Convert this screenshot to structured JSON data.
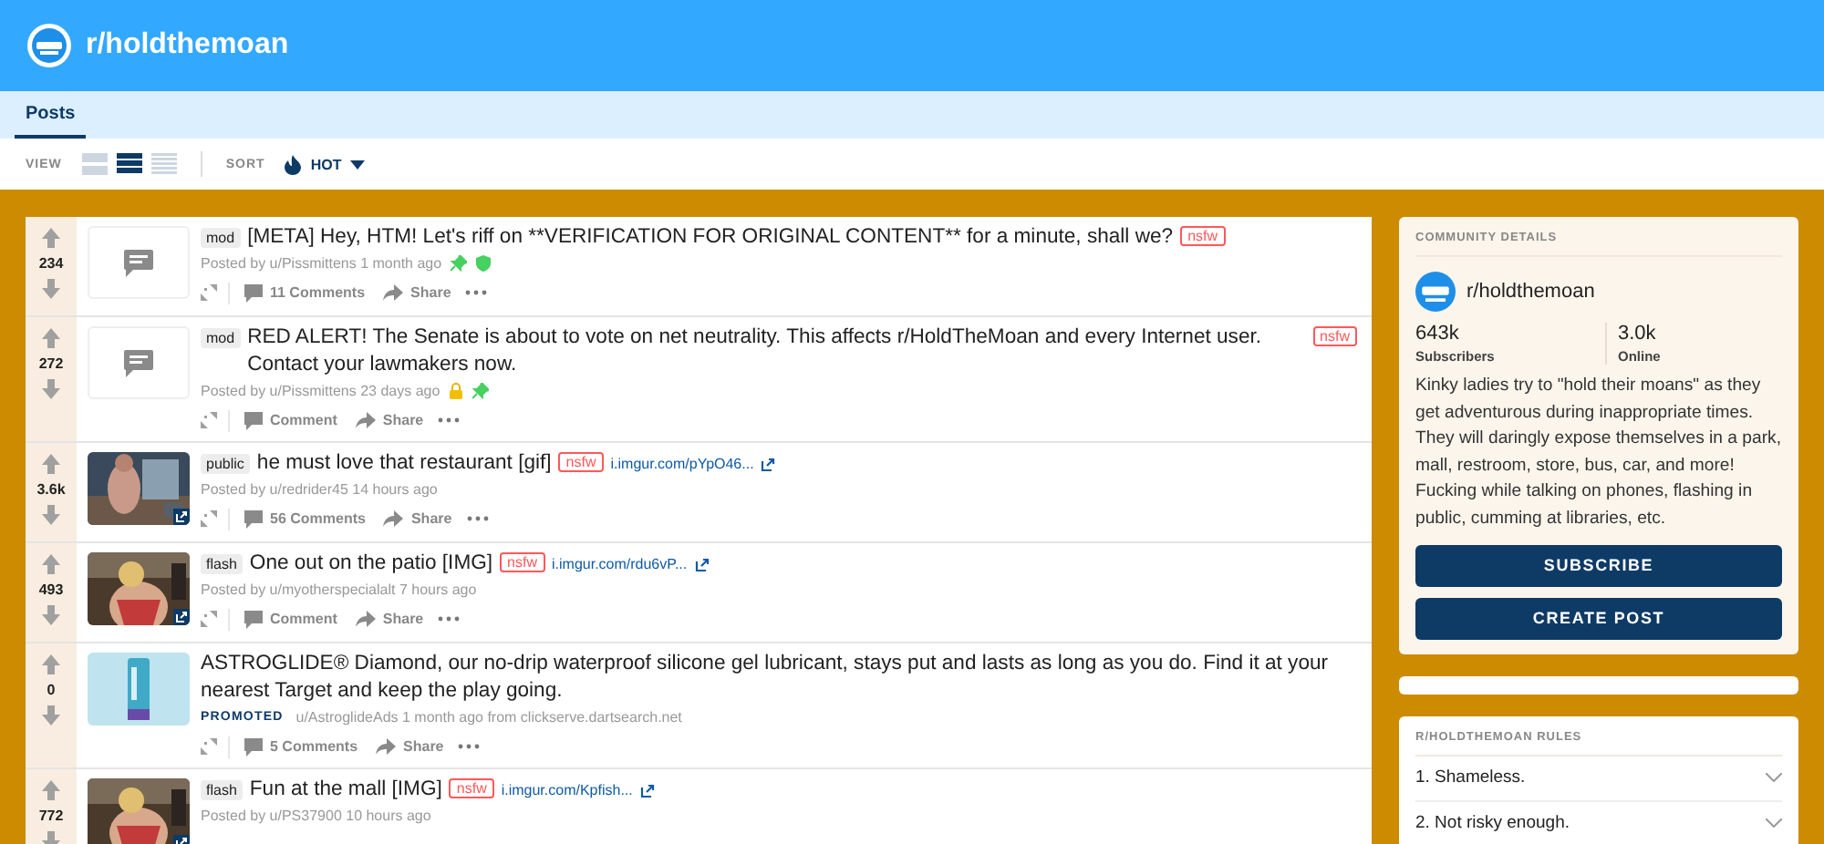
{
  "header": {
    "title": "r/holdthemoan"
  },
  "tabs": [
    {
      "label": "Posts",
      "selected": true
    }
  ],
  "toolbar": {
    "view_label": "VIEW",
    "views": [
      {
        "kind": "card",
        "selected": false
      },
      {
        "kind": "classic",
        "selected": true
      },
      {
        "kind": "compact",
        "selected": false
      }
    ],
    "sort_label": "SORT",
    "sort": "HOT"
  },
  "posts": [
    {
      "kind": "text",
      "votes": "234",
      "flair": "mod",
      "title": "[META] Hey, HTM! Let's riff on **VERIFICATION FOR ORIGINAL CONTENT** for a minute, shall we?",
      "tag": "nsfw",
      "posted_by": "Posted by u/Pissmittens 1 month ago",
      "locked": false,
      "pinned": true,
      "mod_badge": true,
      "comments": "11 Comments",
      "share": "Share"
    },
    {
      "kind": "text",
      "votes": "272",
      "flair": "mod",
      "title": "RED ALERT! The Senate is about to vote on net neutrality. This affects r/HoldTheMoan and every Internet user. Contact your lawmakers now.",
      "tag": "nsfw",
      "posted_by": "Posted by u/Pissmittens 23 days ago",
      "locked": true,
      "pinned": true,
      "mod_badge": false,
      "comments": "Comment",
      "share": "Share"
    },
    {
      "kind": "link",
      "votes": "3.6k",
      "flair": "public",
      "title": "he must love that restaurant [gif]",
      "tag": "nsfw",
      "domain": "i.imgur.com/pYpO46...",
      "posted_by": "Posted by u/redrider45 14 hours ago",
      "locked": false,
      "pinned": false,
      "mod_badge": false,
      "comments": "56 Comments",
      "share": "Share"
    },
    {
      "kind": "link",
      "votes": "493",
      "flair": "flash",
      "title": "One out on the patio [IMG]",
      "tag": "nsfw",
      "domain": "i.imgur.com/rdu6vP...",
      "posted_by": "Posted by u/myotherspecialalt 7 hours ago",
      "locked": false,
      "pinned": false,
      "mod_badge": false,
      "comments": "Comment",
      "share": "Share"
    },
    {
      "kind": "promoted",
      "votes": "0",
      "title": "ASTROGLIDE® Diamond, our no-drip waterproof silicone gel lubricant, stays put and lasts as long as you do. Find it at your nearest Target and keep the play going.",
      "promoted_label": "PROMOTED",
      "posted_by": "u/AstroglideAds 1 month ago from clickserve.dartsearch.net",
      "locked": false,
      "pinned": false,
      "mod_badge": false,
      "comments": "5 Comments",
      "share": "Share"
    },
    {
      "kind": "link",
      "votes": "772",
      "flair": "flash",
      "title": "Fun at the mall [IMG]",
      "tag": "nsfw",
      "domain": "i.imgur.com/Kpfish...",
      "posted_by": "Posted by u/PS37900 10 hours ago",
      "locked": false,
      "pinned": false,
      "mod_badge": false
    }
  ],
  "community": {
    "heading": "COMMUNITY DETAILS",
    "name": "r/holdthemoan",
    "stats": [
      {
        "value": "643k",
        "label": "Subscribers"
      },
      {
        "value": "3.0k",
        "label": "Online"
      }
    ],
    "description": "Kinky ladies try to \"hold their moans\" as they get adventurous during inappropriate times. They will daringly expose themselves in a park, mall, restroom, store, bus, car, and more! Fucking while talking on phones, flashing in public, cumming at libraries, etc.",
    "buttons": [
      "SUBSCRIBE",
      "CREATE POST"
    ]
  },
  "rules": {
    "heading": "R/HOLDTHEMOAN RULES",
    "items": [
      "1. Shameless.",
      "2. Not risky enough."
    ]
  }
}
